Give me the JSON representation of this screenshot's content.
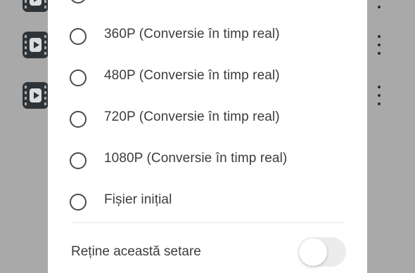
{
  "background": {
    "rows": [
      {
        "has_video_icon": true,
        "has_more_icon": true
      },
      {
        "has_video_icon": true,
        "has_more_icon": true
      },
      {
        "has_video_icon": true,
        "has_more_icon": true
      }
    ]
  },
  "dialog": {
    "options": [
      {
        "label": "",
        "selected": false
      },
      {
        "label": "360P (Conversie în timp real)",
        "selected": false
      },
      {
        "label": "480P (Conversie în timp real)",
        "selected": false
      },
      {
        "label": "720P (Conversie în timp real)",
        "selected": false
      },
      {
        "label": "1080P (Conversie în timp real)",
        "selected": false
      },
      {
        "label": "Fișier inițial",
        "selected": false
      }
    ],
    "remember_setting": {
      "label": "Reține această setare",
      "enabled": false
    }
  },
  "colors": {
    "overlay": "#a9a9a9",
    "dialog_bg": "#ffffff",
    "text": "#3c3c3c",
    "radio_border": "#4a4a4a",
    "toggle_off": "#ececec"
  }
}
